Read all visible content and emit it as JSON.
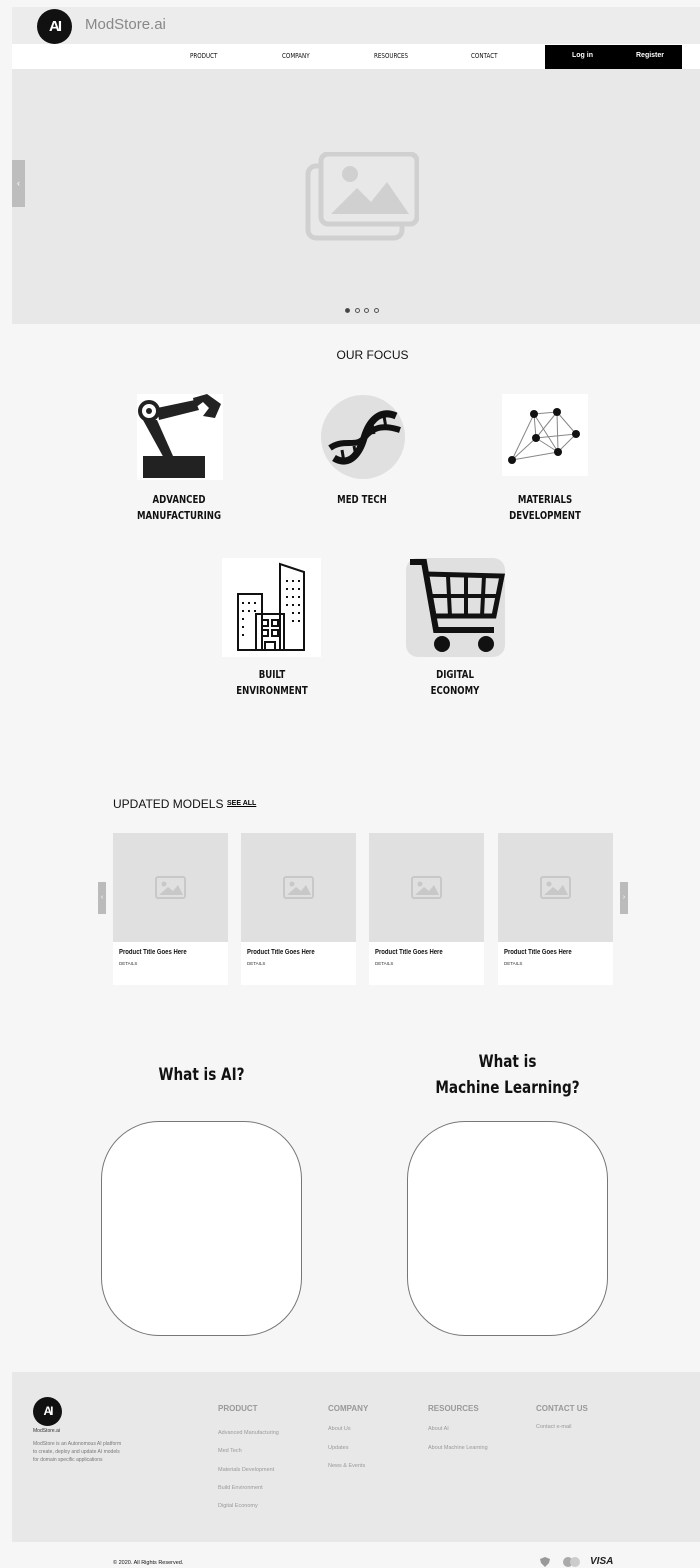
{
  "header": {
    "logo_text": "AI",
    "brand": "ModStore.ai",
    "nav": [
      "PRODUCT",
      "COMPANY",
      "RESOURCES",
      "CONTACT"
    ],
    "login": "Log in",
    "register": "Register"
  },
  "hero": {
    "slide_count": 4,
    "active_slide": 1,
    "prev_icon": "chevron-left-icon",
    "image_icon": "image-gallery-icon"
  },
  "focus": {
    "title": "OUR FOCUS",
    "items": [
      {
        "line1": "ADVANCED",
        "line2": "MANUFACTURING",
        "icon": "robot-arm-icon"
      },
      {
        "line1": "MED TECH",
        "line2": "",
        "icon": "dna-icon"
      },
      {
        "line1": "MATERIALS",
        "line2": "DEVELOPMENT",
        "icon": "network-molecule-icon"
      },
      {
        "line1": "BUILT",
        "line2": "ENVIRONMENT",
        "icon": "buildings-icon"
      },
      {
        "line1": "DIGITAL",
        "line2": "ECONOMY",
        "icon": "shopping-cart-icon"
      }
    ]
  },
  "models": {
    "title": "UPDATED MODELS",
    "see_all": "SEE ALL",
    "cards": [
      {
        "title": "Product Title Goes Here",
        "details": "DETAILS"
      },
      {
        "title": "Product Title Goes Here",
        "details": "DETAILS"
      },
      {
        "title": "Product Title Goes Here",
        "details": "DETAILS"
      },
      {
        "title": "Product Title Goes Here",
        "details": "DETAILS"
      }
    ]
  },
  "questions": {
    "ai": {
      "line1": "What is AI?"
    },
    "ml": {
      "line1": "What is",
      "line2": "Machine Learning?"
    }
  },
  "footer": {
    "logo_text": "AI",
    "brand": "ModStore.ai",
    "description": "ModStore is an Autonomous AI platform to create, deploy and update AI models for domain specific applications",
    "product": {
      "head": "PRODUCT",
      "links": [
        "Advanced Manufacturing",
        "Med Tech",
        "Materials Development",
        "Build Environment",
        "Digital Economy"
      ]
    },
    "company": {
      "head": "COMPANY",
      "links": [
        "About Us",
        "Updates",
        "News & Events"
      ]
    },
    "resources": {
      "head": "RESOURCES",
      "links": [
        "About AI",
        "About Machine Learning"
      ]
    },
    "contact": {
      "head": "CONTACT US",
      "links": [
        "Contact e-mail"
      ]
    },
    "copyright": "© 2020. All Rights Reserved.",
    "payment_visa": "VISA"
  }
}
